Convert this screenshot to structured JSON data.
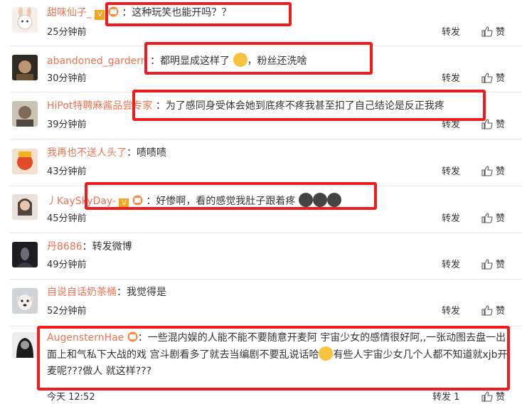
{
  "comments": [
    {
      "user": "甜味仙子_",
      "colon": "：",
      "text": "这种玩笑也能开吗？？",
      "time": "25分钟前",
      "forward": "转发",
      "like": "赞"
    },
    {
      "user": "abandoned_gardern",
      "colon": "：",
      "text": "都明显成这样了",
      "text2": "，粉丝还洗啥",
      "time": "30分钟前",
      "forward": "转发",
      "like": "赞"
    },
    {
      "user": "HiPot特聘麻酱品尝专家",
      "colon": "：",
      "text": "为了感同身受体会她到底疼不疼我甚至扣了自己结论是反正我疼",
      "time": "39分钟前",
      "forward": "转发",
      "like": "赞"
    },
    {
      "user": "我再也不送人头了",
      "colon": "：",
      "text": "啧啧啧",
      "time": "43分钟前",
      "forward": "转发",
      "like": "赞"
    },
    {
      "user": "丿KaySkyDay-",
      "colon": "：",
      "text": "好惨啊，看的感觉我肚子跟着疼",
      "time": "45分钟前",
      "forward": "转发",
      "like": "赞"
    },
    {
      "user": "丹8686",
      "colon": "：",
      "text": "转发微博",
      "time": "49分钟前",
      "forward": "转发",
      "like": "赞"
    },
    {
      "user": "自说自话奶茶桶",
      "colon": "：",
      "text": "我觉得是",
      "time": "52分钟前",
      "forward": "转发",
      "like": "赞"
    },
    {
      "user": "AugensternHae",
      "colon": "：",
      "text": "一些混内娱的人能不能不要随意开麦阿 宇宙少女的感情很好阿,,一张动图去盘一出面上和气私下大战的戏 宫斗剧看多了就去当编剧不要乱说话哈",
      "text2": "有些人宇宙少女几个人都不知道就xjb开麦呢???做人 就这样???",
      "time": "今天 12:52",
      "forward": "转发 1",
      "like": "赞"
    }
  ],
  "colors": {
    "name": "#eb7350",
    "highlight": "#ee1c1c"
  }
}
